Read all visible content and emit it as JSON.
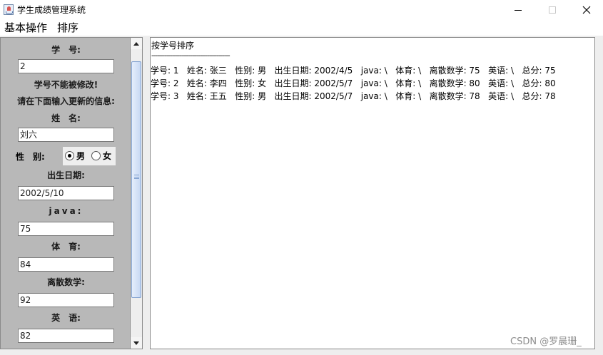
{
  "window": {
    "title": "学生成绩管理系统",
    "icon": "java-cup-icon"
  },
  "menu": {
    "items": [
      "基本操作",
      "排序"
    ]
  },
  "form": {
    "student_id_label": "学　号:",
    "student_id_value": "2",
    "notice": "学号不能被修改!",
    "prompt": "请在下面输入更新的信息:",
    "name_label": "姓　名:",
    "name_value": "刘六",
    "gender_label": "性　别:",
    "gender_options": [
      "男",
      "女"
    ],
    "gender_selected": "男",
    "birth_label": "出生日期:",
    "birth_value": "2002/5/10",
    "java_label": "java:",
    "java_value": "75",
    "pe_label": "体　育:",
    "pe_value": "84",
    "discrete_label": "离散数学:",
    "discrete_value": "92",
    "english_label": "英　语:",
    "english_value": "82"
  },
  "results": {
    "title": "按学号排序",
    "divider": "------------------------------------------",
    "rows": [
      "学号: 1   姓名: 张三   性别: 男   出生日期: 2002/4/5   java: \\   体育: \\   离散数学: 75   英语: \\   总分: 75",
      "学号: 2   姓名: 李四   性别: 女   出生日期: 2002/5/7   java: \\   体育: \\   离散数学: 80   英语: \\   总分: 80",
      "学号: 3   姓名: 王五   性别: 男   出生日期: 2002/5/7   java: \\   体育: \\   离散数学: 78   英语: \\   总分: 78"
    ]
  },
  "watermark": "CSDN @罗晨珊_"
}
